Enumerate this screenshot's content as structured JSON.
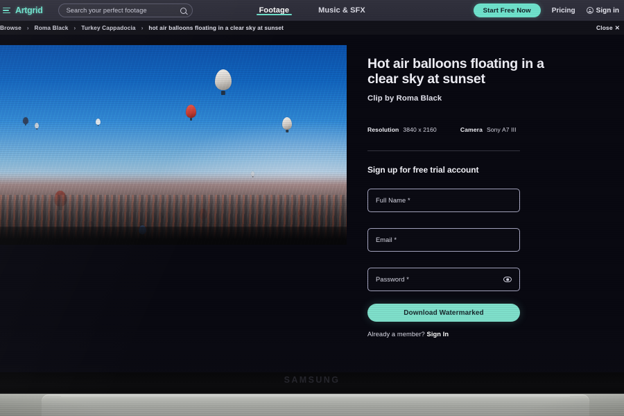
{
  "nav": {
    "logo": "Artgrid",
    "menu_icon": "hamburger-icon",
    "search_placeholder": "Search your perfect footage",
    "search_value": "",
    "search_icon": "search-icon",
    "tabs": [
      {
        "label": "Footage",
        "active": true
      },
      {
        "label": "Music & SFX",
        "active": false
      }
    ],
    "cta_label": "Start Free Now",
    "pricing_label": "Pricing",
    "signin_label": "Sign in",
    "signin_icon": "person-circle-icon",
    "accent_color": "#6fe3cd",
    "bar_color": "#2c2c38"
  },
  "breadcrumb": {
    "items": [
      "Browse",
      "Roma Black",
      "Turkey Cappadocia",
      "hot air balloons floating in a clear sky at sunset"
    ],
    "separator": "›",
    "close_label": "Close",
    "close_icon": "close-x-icon"
  },
  "clip": {
    "title": "Hot air balloons floating in a clear sky at sunset",
    "author_line": "Clip by Roma Black",
    "meta": [
      {
        "key": "Resolution",
        "value": "3840 x 2160"
      },
      {
        "key": "Camera",
        "value": "Sony A7 III"
      }
    ],
    "preview_alt": "hot-air-balloons-over-cappadocia"
  },
  "signup": {
    "heading": "Sign up for free trial account",
    "fields": [
      {
        "label": "Full Name *",
        "value": "",
        "type": "text"
      },
      {
        "label": "Email *",
        "value": "",
        "type": "email"
      },
      {
        "label": "Password *",
        "value": "",
        "type": "password",
        "toggle_icon": "eye-icon"
      }
    ],
    "submit_label": "Download Watermarked",
    "submit_color": "#7fe0cb",
    "already_text": "Already a member? ",
    "already_link": "Sign In"
  },
  "monitor": {
    "brand": "SAMSUNG"
  }
}
